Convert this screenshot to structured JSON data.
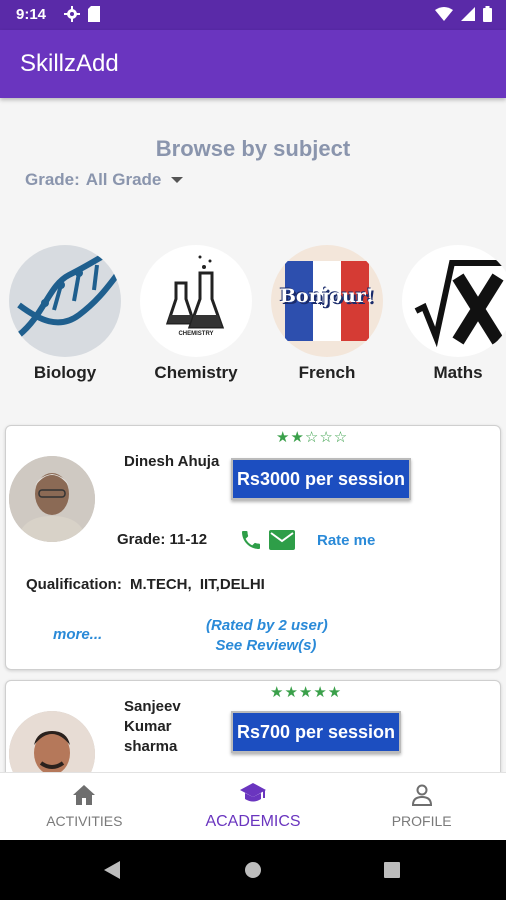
{
  "status_bar": {
    "time": "9:14"
  },
  "app_bar": {
    "title": "SkillzAdd"
  },
  "browse": {
    "title": "Browse by subject",
    "grade_label": "Grade:",
    "grade_value": "All Grade"
  },
  "subjects": [
    {
      "label": "Biology",
      "icon": "dna-icon"
    },
    {
      "label": "Chemistry",
      "icon": "lab-flask-icon",
      "icon_caption": "CHEMISTRY"
    },
    {
      "label": "French",
      "icon": "bonjour-flag-icon",
      "icon_caption": "Bonjour!"
    },
    {
      "label": "Maths",
      "icon": "sqrt-x-icon",
      "icon_caption": "√X"
    }
  ],
  "tutors": [
    {
      "name": "Dinesh Ahuja",
      "rating": 2,
      "rating_max": 5,
      "price": "Rs3000 per session",
      "grade_label": "Grade:",
      "grade_value": "11-12",
      "rate_me": "Rate me",
      "qualification_label": "Qualification:",
      "qualification_value": "M.TECH, IIT,DELHI",
      "more": "more...",
      "rated_by": "(Rated by 2 user)",
      "see_reviews": "See Review(s)"
    },
    {
      "name": "Sanjeev Kumar sharma",
      "rating": 5,
      "rating_max": 5,
      "price": "Rs700 per session"
    }
  ],
  "bottom_nav": [
    {
      "label": "ACTIVITIES",
      "icon": "home-icon",
      "active": false
    },
    {
      "label": "ACADEMICS",
      "icon": "graduation-cap-icon",
      "active": true
    },
    {
      "label": "PROFILE",
      "icon": "person-icon",
      "active": false
    }
  ],
  "colors": {
    "primary": "#6a35bf",
    "status_bar": "#5a2aa8",
    "price_button": "#1c4ec0",
    "link": "#2a8ad8",
    "star": "#3aa04a"
  }
}
